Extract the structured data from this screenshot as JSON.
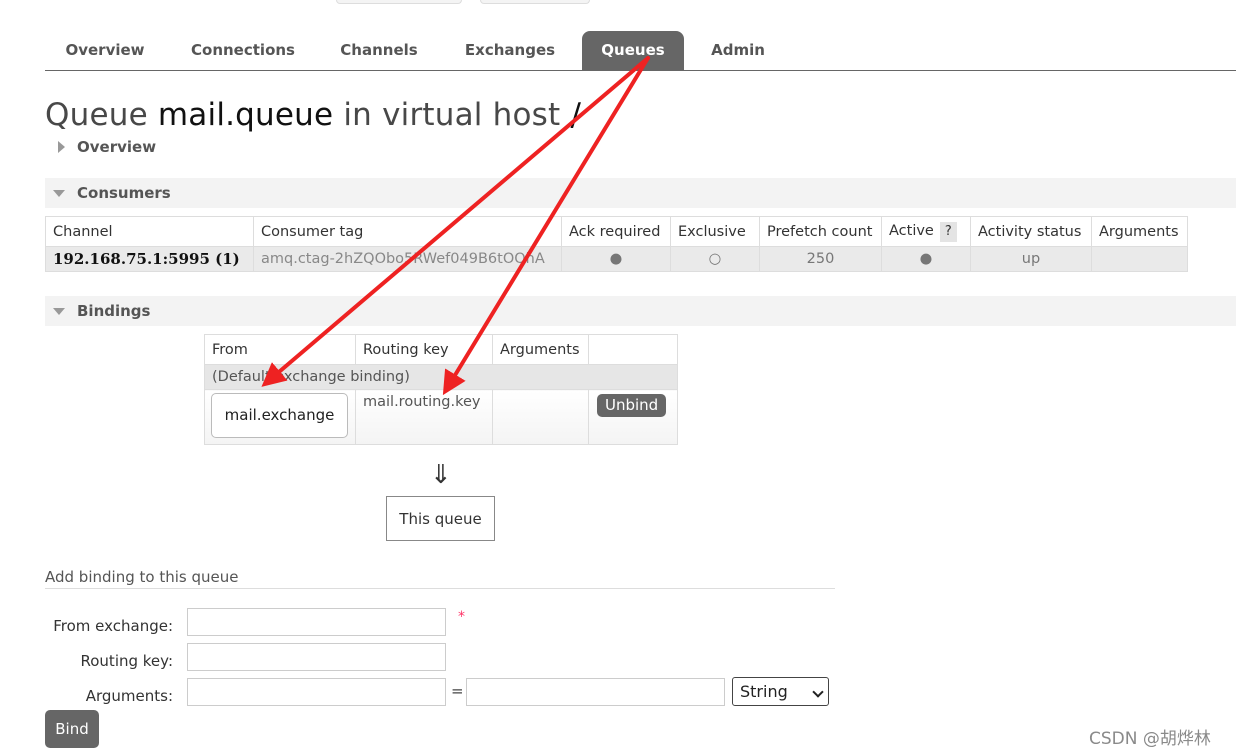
{
  "nav": {
    "tabs": [
      "Overview",
      "Connections",
      "Channels",
      "Exchanges",
      "Queues",
      "Admin"
    ],
    "active_tab": "Queues"
  },
  "page": {
    "title_prefix": "Queue ",
    "queue_name": "mail.queue",
    "title_mid": " in virtual host ",
    "vhost": "/"
  },
  "sections": {
    "overview": "Overview",
    "consumers": "Consumers",
    "bindings": "Bindings"
  },
  "consumers": {
    "headers": [
      "Channel",
      "Consumer tag",
      "Ack required",
      "Exclusive",
      "Prefetch count",
      "Active",
      "Activity status",
      "Arguments"
    ],
    "help_label": "?",
    "row": {
      "channel": "192.168.75.1:5995 (1)",
      "consumer_tag": "amq.ctag-2hZQObo5RWef049B6tOQhA",
      "ack_required": "●",
      "exclusive": "○",
      "prefetch_count": "250",
      "active": "●",
      "activity_status": "up",
      "arguments": ""
    }
  },
  "bindings": {
    "headers": [
      "From",
      "Routing key",
      "Arguments",
      ""
    ],
    "default_binding": "(Default exchange binding)",
    "row": {
      "from": "mail.exchange",
      "routing_key": "mail.routing.key",
      "arguments": "",
      "unbind_label": "Unbind"
    },
    "arrow_glyph": "⇓",
    "this_queue": "This queue"
  },
  "add_binding": {
    "heading": "Add binding to this queue",
    "from_exchange_label": "From exchange:",
    "routing_key_label": "Routing key:",
    "arguments_label": "Arguments:",
    "required_mark": "*",
    "equals": "=",
    "type_selected": "String",
    "submit_label": "Bind",
    "from_exchange_value": "",
    "routing_key_value": "",
    "arg_key_value": "",
    "arg_value_value": ""
  },
  "watermark": "CSDN @胡烨林",
  "annotation_color": "#ee2222"
}
